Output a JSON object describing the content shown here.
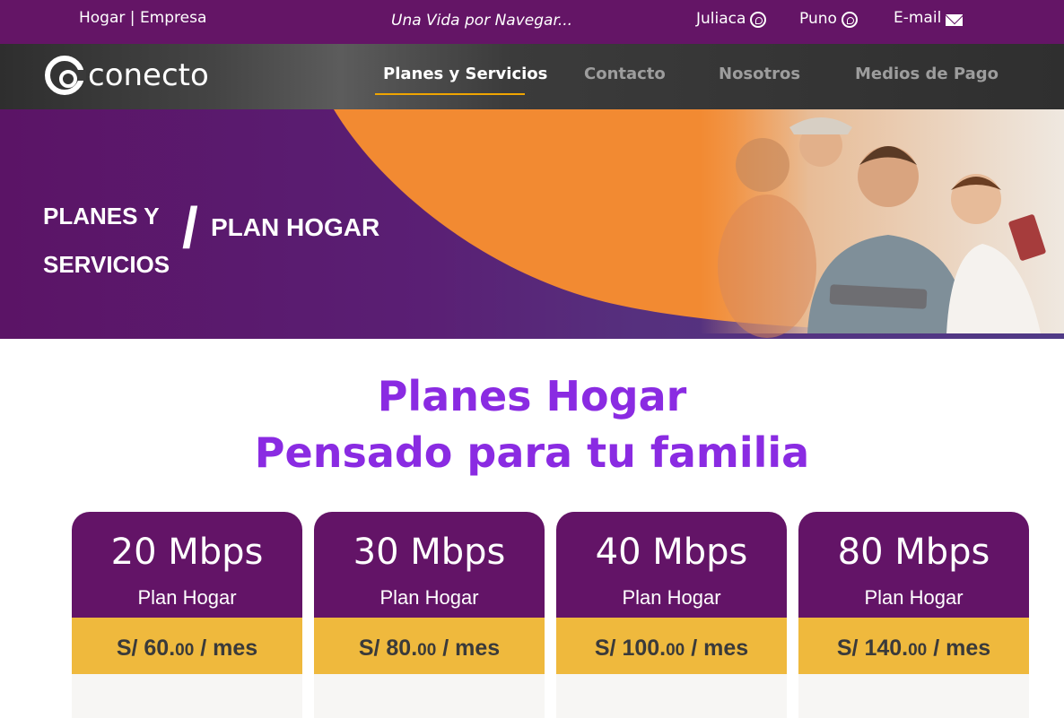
{
  "topbar": {
    "hogar": "Hogar",
    "separator": "|",
    "empresa": "Empresa",
    "tagline": "Una Vida por Navegar...",
    "juliaca": "Juliaca",
    "puno": "Puno",
    "email": "E-mail"
  },
  "nav": {
    "logo_text": "conecto",
    "items": [
      "Planes y Servicios",
      "Contacto",
      "Nosotros",
      "Medios de Pago"
    ],
    "active": "Planes y Servicios"
  },
  "hero": {
    "line1": "PLANES Y",
    "line2": "SERVICIOS",
    "slash": "/",
    "subtitle": "PLAN HOGAR"
  },
  "section": {
    "title1": "Planes Hogar",
    "title2": "Pensado para tu familia"
  },
  "plans": [
    {
      "speed": "20 Mbps",
      "name": "Plan Hogar",
      "price_main": "S/ 60.",
      "price_cents": "00",
      "price_suffix": " / mes"
    },
    {
      "speed": "30 Mbps",
      "name": "Plan Hogar",
      "price_main": "S/ 80.",
      "price_cents": "00",
      "price_suffix": " / mes"
    },
    {
      "speed": "40 Mbps",
      "name": "Plan Hogar",
      "price_main": "S/ 100.",
      "price_cents": "00",
      "price_suffix": " / mes"
    },
    {
      "speed": "80 Mbps",
      "name": "Plan Hogar",
      "price_main": "S/ 140.",
      "price_cents": "00",
      "price_suffix": " / mes"
    }
  ],
  "colors": {
    "topbar": "#641566",
    "accent_orange": "#f28a32",
    "card_head": "#631467",
    "card_price": "#efb93d",
    "heading": "#8a2be2"
  },
  "icons": [
    "whatsapp-icon",
    "email-icon"
  ]
}
